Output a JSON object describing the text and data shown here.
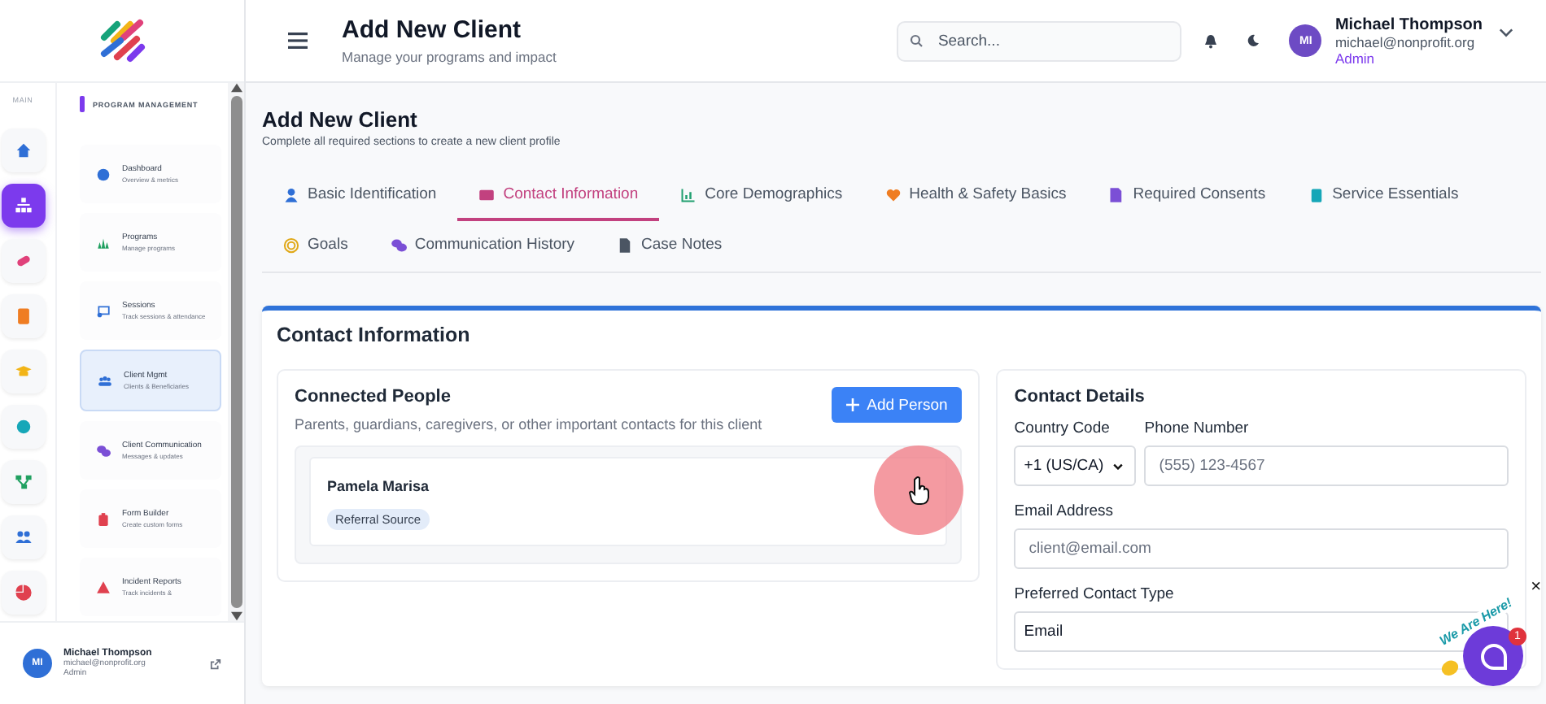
{
  "sidebar": {
    "rail_label": "MAIN",
    "rail": [
      {
        "selected": false
      },
      {
        "selected": true
      },
      {
        "selected": false
      },
      {
        "selected": false
      },
      {
        "selected": false
      },
      {
        "selected": false
      },
      {
        "selected": false
      },
      {
        "selected": false
      },
      {
        "selected": false
      }
    ],
    "section_title": "PROGRAM MANAGEMENT",
    "items": [
      {
        "title": "Dashboard",
        "subtitle": "Overview & metrics",
        "selected": false
      },
      {
        "title": "Programs",
        "subtitle": "Manage programs",
        "selected": false
      },
      {
        "title": "Sessions",
        "subtitle": "Track sessions & attendance",
        "selected": false
      },
      {
        "title": "Client Mgmt",
        "subtitle": "Clients & Beneficiaries",
        "selected": true
      },
      {
        "title": "Client Communication",
        "subtitle": "Messages & updates",
        "selected": false
      },
      {
        "title": "Form Builder",
        "subtitle": "Create custom forms",
        "selected": false
      },
      {
        "title": "Incident Reports",
        "subtitle": "Track incidents &",
        "selected": false
      }
    ],
    "user": {
      "initials": "MI",
      "name": "Michael Thompson",
      "email": "michael@nonprofit.org",
      "role": "Admin"
    }
  },
  "header": {
    "title": "Add New Client",
    "subtitle": "Manage your programs and impact",
    "search": {
      "placeholder": "Search..."
    },
    "user": {
      "initials": "MI",
      "name": "Michael Thompson",
      "email": "michael@nonprofit.org",
      "role": "Admin"
    }
  },
  "page": {
    "title": "Add New Client",
    "subtitle": "Complete all required sections to create a new client profile"
  },
  "tabs": [
    {
      "label": "Basic Identification",
      "selected": false
    },
    {
      "label": "Contact Information",
      "selected": true
    },
    {
      "label": "Core Demographics",
      "selected": false
    },
    {
      "label": "Health & Safety Basics",
      "selected": false
    },
    {
      "label": "Required Consents",
      "selected": false
    },
    {
      "label": "Service Essentials",
      "selected": false
    },
    {
      "label": "Goals",
      "selected": false
    },
    {
      "label": "Communication History",
      "selected": false
    },
    {
      "label": "Case Notes",
      "selected": false
    }
  ],
  "section": {
    "title": "Contact Information",
    "connected_people": {
      "title": "Connected People",
      "description": "Parents, guardians, caregivers, or other important contacts for this client",
      "add_button": "Add Person",
      "people": [
        {
          "name": "Pamela Marisa",
          "tag": "Referral Source"
        }
      ]
    },
    "contact_details": {
      "title": "Contact Details",
      "country_code": {
        "label": "Country Code",
        "value": "+1 (US/CA)"
      },
      "phone": {
        "label": "Phone Number",
        "placeholder": "(555) 123-4567"
      },
      "email": {
        "label": "Email Address",
        "placeholder": "client@email.com"
      },
      "preferred_contact": {
        "label": "Preferred Contact Type",
        "value": "Email"
      }
    }
  },
  "chat_widget": {
    "caption": "We Are Here!",
    "badge": "1",
    "close": "×"
  }
}
